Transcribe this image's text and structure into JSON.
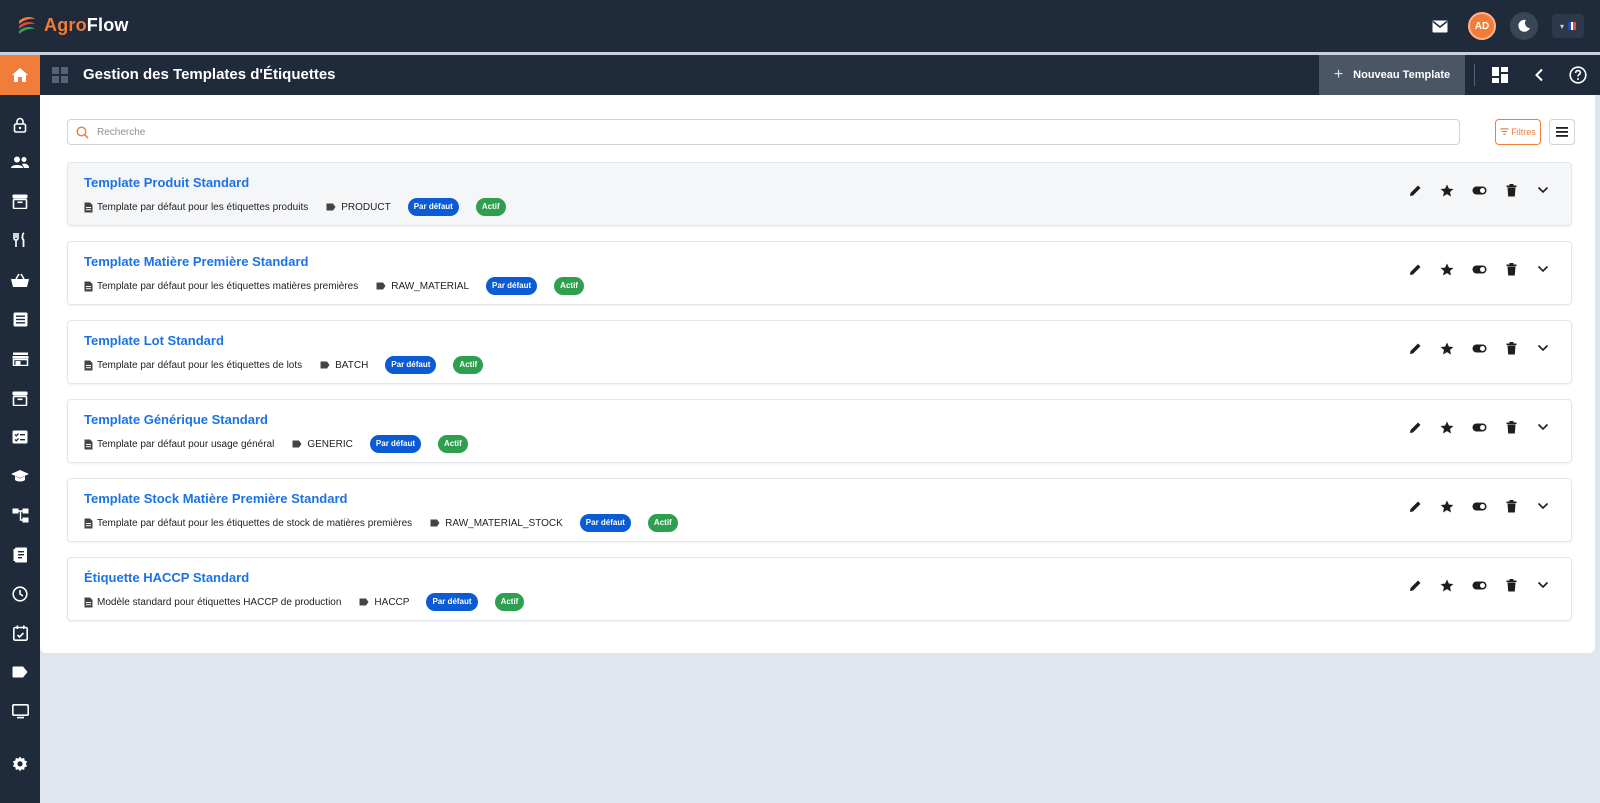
{
  "app": {
    "brand_prefix": "Agro",
    "brand_suffix": "Flow"
  },
  "topbar": {
    "avatar_initials": "AD"
  },
  "header": {
    "title": "Gestion des Templates d'Étiquettes",
    "new_button": "Nouveau Template"
  },
  "search": {
    "placeholder": "Recherche",
    "value": ""
  },
  "filters_label": "Filtres",
  "sidebar": {
    "items": [
      "home-icon",
      "lock-icon",
      "users-icon",
      "archive-icon",
      "utensils-icon",
      "basket-icon",
      "list-icon",
      "store-icon",
      "archive-box-icon",
      "checklist-icon",
      "graduation-cap-icon",
      "hierarchy-icon",
      "book-icon",
      "clock-icon",
      "calendar-check-icon",
      "tag-icon",
      "monitor-icon",
      "settings-icon"
    ]
  },
  "templates": [
    {
      "title": "Template Produit Standard",
      "description": "Template par défaut pour les étiquettes produits",
      "type": "PRODUCT",
      "default_badge": "Par défaut",
      "status_badge": "Actif"
    },
    {
      "title": "Template Matière Première Standard",
      "description": "Template par défaut pour les étiquettes matières premières",
      "type": "RAW_MATERIAL",
      "default_badge": "Par défaut",
      "status_badge": "Actif"
    },
    {
      "title": "Template Lot Standard",
      "description": "Template par défaut pour les étiquettes de lots",
      "type": "BATCH",
      "default_badge": "Par défaut",
      "status_badge": "Actif"
    },
    {
      "title": "Template Générique Standard",
      "description": "Template par défaut pour usage général",
      "type": "GENERIC",
      "default_badge": "Par défaut",
      "status_badge": "Actif"
    },
    {
      "title": "Template Stock Matière Première Standard",
      "description": "Template par défaut pour les étiquettes de stock de matières premières",
      "type": "RAW_MATERIAL_STOCK",
      "default_badge": "Par défaut",
      "status_badge": "Actif"
    },
    {
      "title": "Étiquette HACCP Standard",
      "description": "Modèle standard pour étiquettes HACCP de production",
      "type": "HACCP",
      "default_badge": "Par défaut",
      "status_badge": "Actif"
    }
  ],
  "colors": {
    "accent": "#f07d3a",
    "nav_bg": "#1f2a3a",
    "link": "#1a73e8",
    "badge_default": "#0a5bd4",
    "badge_active": "#2e9e4f"
  }
}
